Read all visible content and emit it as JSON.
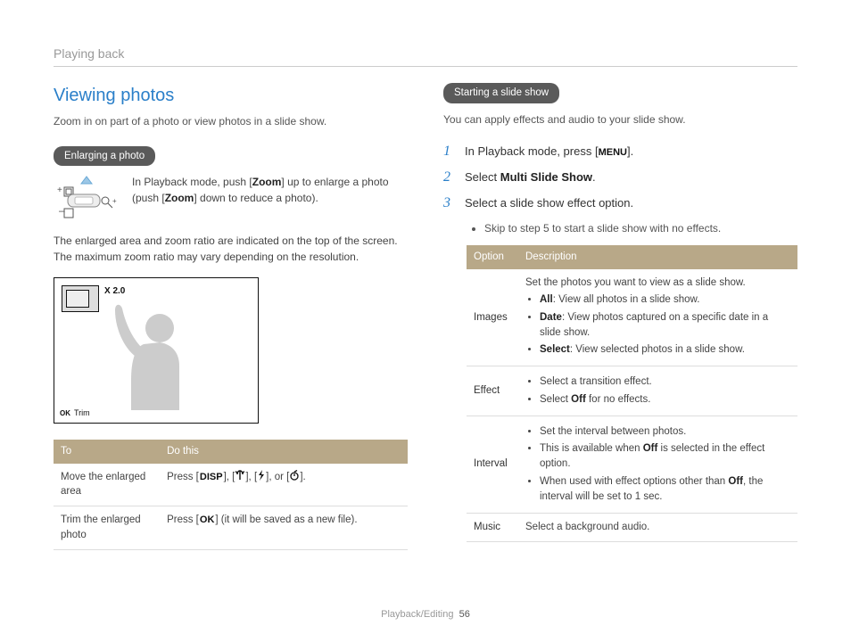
{
  "header": {
    "section": "Playing back"
  },
  "left": {
    "title": "Viewing photos",
    "intro": "Zoom in on part of a photo or view photos in a slide show.",
    "sub1": "Enlarging a photo",
    "zoom_pre": "In Playback mode, push [",
    "zoom_key": "Zoom",
    "zoom_mid": "] up to enlarge a photo (push [",
    "zoom_post": "] down to reduce a photo).",
    "para": "The enlarged area and zoom ratio are indicated on the top of the screen. The maximum zoom ratio may vary depending on the resolution.",
    "preview": {
      "zoom_label": "X 2.0",
      "trim": "Trim",
      "ok": "OK"
    },
    "table": {
      "h1": "To",
      "h2": "Do this",
      "rows": [
        {
          "to": "Move the enlarged area",
          "do_pre": "Press [",
          "k1": "DISP",
          "mid1": "], [",
          "mid2": "], [",
          "mid3": "], or [",
          "do_post": "]."
        },
        {
          "to": "Trim the enlarged photo",
          "do_pre": "Press [",
          "k1": "OK",
          "do_post": "] (it will be saved as a new file)."
        }
      ]
    }
  },
  "right": {
    "sub": "Starting a slide show",
    "intro": "You can apply effects and audio to your slide show.",
    "steps": {
      "s1_pre": "In Playback mode, press [",
      "s1_key": "MENU",
      "s1_post": "].",
      "s2_pre": "Select ",
      "s2_key": "Multi Slide Show",
      "s2_post": ".",
      "s3": "Select a slide show effect option."
    },
    "sub_bullet": "Skip to step 5 to start a slide show with no effects.",
    "opts": {
      "h1": "Option",
      "h2": "Description",
      "images": {
        "label": "Images",
        "lead": "Set the photos you want to view as a slide show.",
        "b1a": "All",
        "b1b": ": View all photos in a slide show.",
        "b2a": "Date",
        "b2b": ": View photos captured on a specific date in a slide show.",
        "b3a": "Select",
        "b3b": ": View selected photos in a slide show."
      },
      "effect": {
        "label": "Effect",
        "b1": "Select a transition effect.",
        "b2a": "Select ",
        "b2b": "Off",
        "b2c": " for no effects."
      },
      "interval": {
        "label": "Interval",
        "b1": "Set the interval between photos.",
        "b2a": "This is available when ",
        "b2b": "Off",
        "b2c": " is selected in the effect option.",
        "b3a": "When used with effect options other than ",
        "b3b": "Off",
        "b3c": ", the interval will be set to 1 sec."
      },
      "music": {
        "label": "Music",
        "desc": "Select a background audio."
      }
    }
  },
  "footer": {
    "section": "Playback/Editing",
    "page": "56"
  }
}
